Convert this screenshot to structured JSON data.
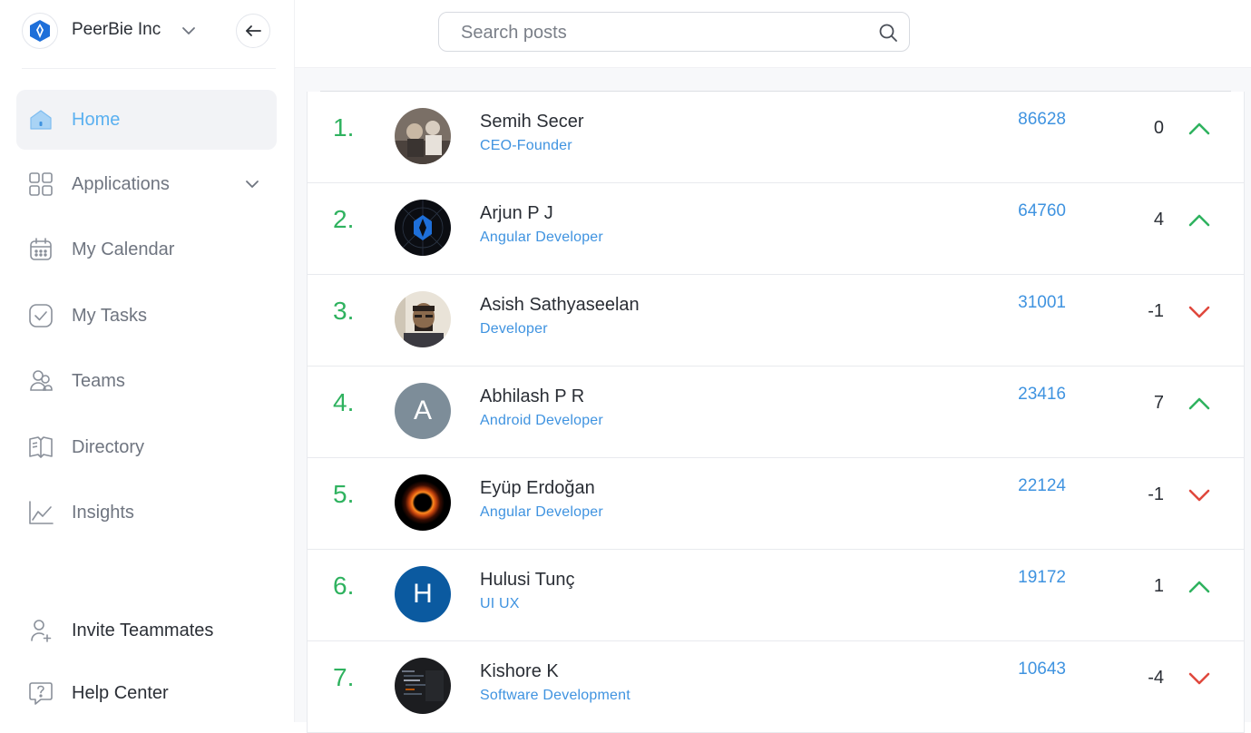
{
  "org": {
    "name": "PeerBie Inc"
  },
  "search": {
    "placeholder": "Search posts"
  },
  "nav": [
    {
      "label": "Home",
      "icon": "home-icon",
      "active": true
    },
    {
      "label": "Applications",
      "icon": "grid-icon",
      "active": false
    },
    {
      "label": "My Calendar",
      "icon": "calendar-icon",
      "active": false
    },
    {
      "label": "My Tasks",
      "icon": "task-check-icon",
      "active": false
    },
    {
      "label": "Teams",
      "icon": "team-icon",
      "active": false
    },
    {
      "label": "Directory",
      "icon": "book-icon",
      "active": false
    },
    {
      "label": "Insights",
      "icon": "chart-line-icon",
      "active": false
    }
  ],
  "nav_bottom": [
    {
      "label": "Invite Teammates",
      "icon": "add-user-icon"
    },
    {
      "label": "Help Center",
      "icon": "help-chat-icon"
    }
  ],
  "colors": {
    "accent": "#3f93e0",
    "rank": "#2fb25f",
    "up": "#2fb25f",
    "down": "#e0483d",
    "active_nav": "#5ab0f0"
  },
  "leaderboard": [
    {
      "rank": "1.",
      "name": "Semih Secer",
      "role": "CEO-Founder",
      "score": "86628",
      "change": "0",
      "trend": "up",
      "avatar": "photo-group"
    },
    {
      "rank": "2.",
      "name": "Arjun P J",
      "role": "Angular Developer",
      "score": "64760",
      "change": "4",
      "trend": "up",
      "avatar": "logo-dark"
    },
    {
      "rank": "3.",
      "name": "Asish Sathyaseelan",
      "role": "Developer",
      "score": "31001",
      "change": "-1",
      "trend": "down",
      "avatar": "photo-person"
    },
    {
      "rank": "4.",
      "name": "Abhilash P R",
      "role": "Android Developer",
      "score": "23416",
      "change": "7",
      "trend": "up",
      "avatar": "letter",
      "letter": "A",
      "avatar_color": "#7d8d99"
    },
    {
      "rank": "5.",
      "name": "Eyüp Erdoğan",
      "role": "Angular Developer",
      "score": "22124",
      "change": "-1",
      "trend": "down",
      "avatar": "photo-blackhole"
    },
    {
      "rank": "6.",
      "name": "Hulusi Tunç",
      "role": "UI UX",
      "score": "19172",
      "change": "1",
      "trend": "up",
      "avatar": "letter",
      "letter": "H",
      "avatar_color": "#0b5aa0"
    },
    {
      "rank": "7.",
      "name": "Kishore K",
      "role": "Software Development",
      "score": "10643",
      "change": "-4",
      "trend": "down",
      "avatar": "photo-code"
    }
  ]
}
